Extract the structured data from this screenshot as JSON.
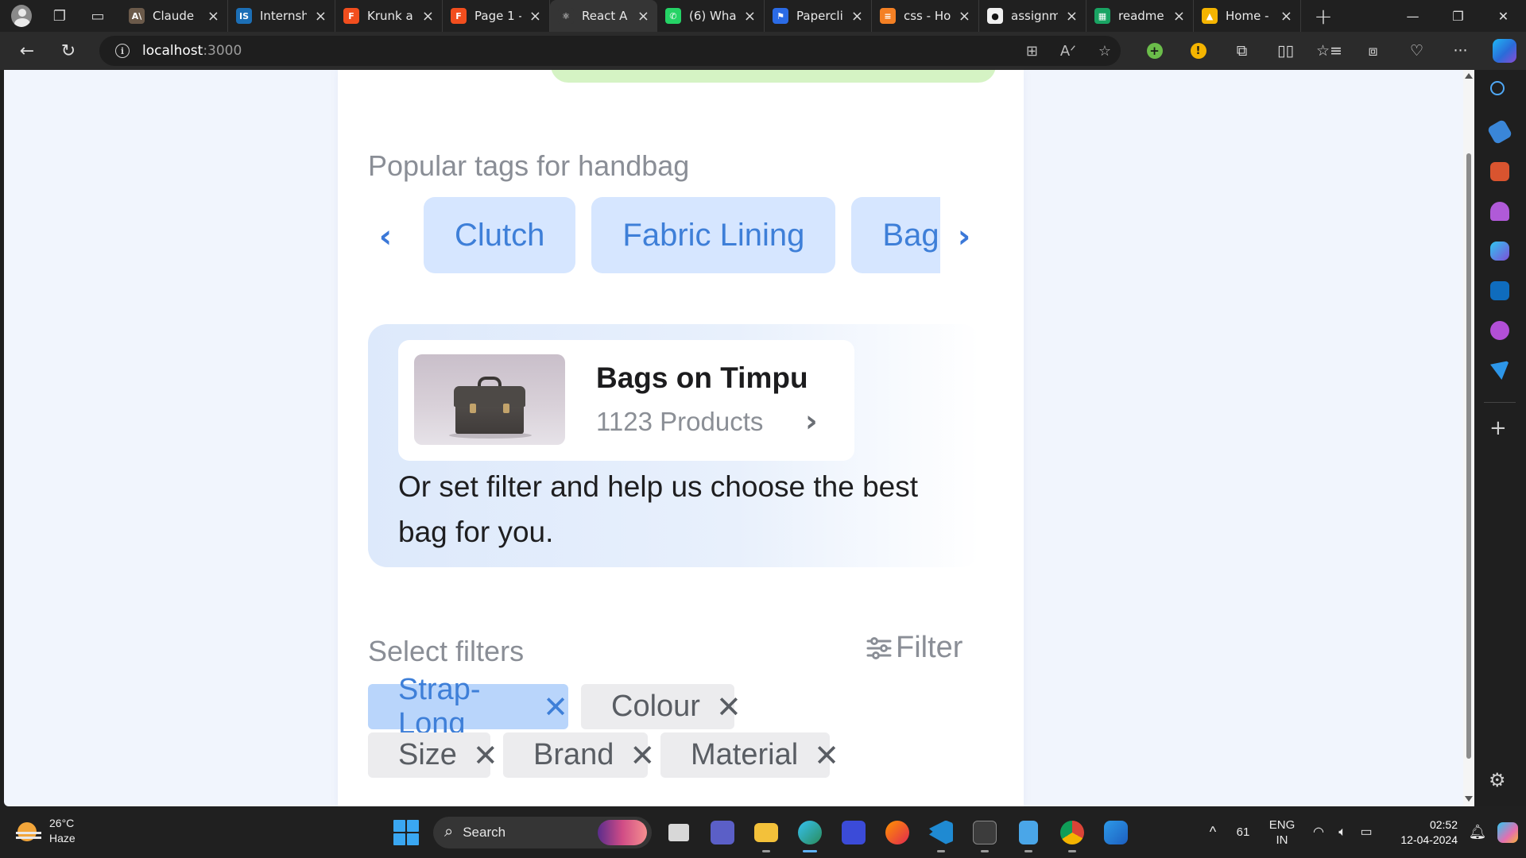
{
  "browser": {
    "tabs": [
      {
        "label": "Claude",
        "favicon": "claude-icon",
        "color": "#6b5a4a",
        "glyph": "A\\"
      },
      {
        "label": "Internsh",
        "favicon": "internshala-icon",
        "color": "#1c6fb6",
        "glyph": "IS"
      },
      {
        "label": "Krunk a",
        "favicon": "figma-icon",
        "color": "#f24e1e",
        "glyph": "F"
      },
      {
        "label": "Page 1 -",
        "favicon": "figma-icon",
        "color": "#f24e1e",
        "glyph": "F"
      },
      {
        "label": "React A",
        "favicon": "react-icon",
        "color": "#353535",
        "glyph": "⚛",
        "active": true
      },
      {
        "label": "(6) Wha",
        "favicon": "whatsapp-icon",
        "color": "#25d366",
        "glyph": "✆"
      },
      {
        "label": "Papercli",
        "favicon": "paperclip-icon",
        "color": "#2b6be6",
        "glyph": "⚑"
      },
      {
        "label": "css - Ho",
        "favicon": "stackoverflow-icon",
        "color": "#f48024",
        "glyph": "≡"
      },
      {
        "label": "assignm",
        "favicon": "github-icon",
        "color": "#f0f0f0",
        "glyph": "●"
      },
      {
        "label": "readme.",
        "favicon": "sheets-icon",
        "color": "#19a463",
        "glyph": "▦"
      },
      {
        "label": "Home -",
        "favicon": "drive-icon",
        "color": "#f4b400",
        "glyph": "▲"
      }
    ],
    "url_host": "localhost",
    "url_port": ":3000"
  },
  "page": {
    "popular_title": "Popular tags for handbag",
    "tags": [
      "Clutch",
      "Fabric Lining",
      "Baggit"
    ],
    "promo": {
      "title": "Bags on Timpu",
      "count": "1123 Products",
      "text": "Or set filter and help us choose the best bag for you."
    },
    "filters_title": "Select filters",
    "filter_button": "Filter",
    "filters": [
      {
        "label": "Strap-Long",
        "active": true
      },
      {
        "label": "Colour",
        "active": false
      },
      {
        "label": "Size",
        "active": false
      },
      {
        "label": "Brand",
        "active": false
      },
      {
        "label": "Material",
        "active": false
      }
    ],
    "colors": {
      "accent": "#3e7fd8",
      "chip_bg": "#d6e6ff",
      "active_filter_bg": "#b9d5fb",
      "promo_strip": "#d5f3c4"
    }
  },
  "taskbar": {
    "weather_temp": "26°C",
    "weather_desc": "Haze",
    "search_label": "Search",
    "battery": "61",
    "lang_top": "ENG",
    "lang_bottom": "IN",
    "time": "02:52",
    "date": "12-04-2024"
  }
}
